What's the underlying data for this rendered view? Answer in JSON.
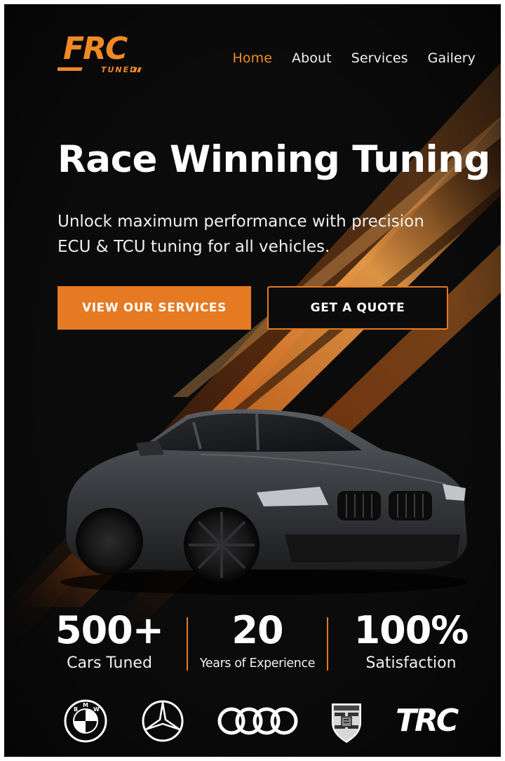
{
  "brand": {
    "logo_text": "FRC",
    "logo_subtext": "TUNED",
    "accent_color": "#e57a23",
    "logo_icon": "frc-tuned-logo"
  },
  "nav": {
    "items": [
      {
        "label": "Home",
        "active": true
      },
      {
        "label": "About",
        "active": false
      },
      {
        "label": "Services",
        "active": false
      },
      {
        "label": "Gailery",
        "active": false
      }
    ]
  },
  "hero": {
    "title": "Race Winning Tuning",
    "subtitle": "Unlock maximum performance with precision ECU & TCU tuning for all vehicles.",
    "primary_cta": "VIEW OUR SERVICES",
    "secondary_cta": "GET A QUOTE",
    "image": "dark-grey-sports-car"
  },
  "stats": [
    {
      "value": "500+",
      "label": "Cars Tuned"
    },
    {
      "value": "20",
      "label": "Years of Experience"
    },
    {
      "value": "100%",
      "label": "Satisfaction"
    }
  ],
  "brands": {
    "items": [
      {
        "name": "bmw",
        "icon": "bmw-logo-icon",
        "letters": "BMW"
      },
      {
        "name": "mercedes",
        "icon": "mercedes-logo-icon"
      },
      {
        "name": "audi",
        "icon": "audi-logo-icon"
      },
      {
        "name": "porsche",
        "icon": "porsche-crest-icon"
      },
      {
        "name": "trc",
        "icon": "trc-logo-icon",
        "text": "TRC"
      }
    ]
  }
}
